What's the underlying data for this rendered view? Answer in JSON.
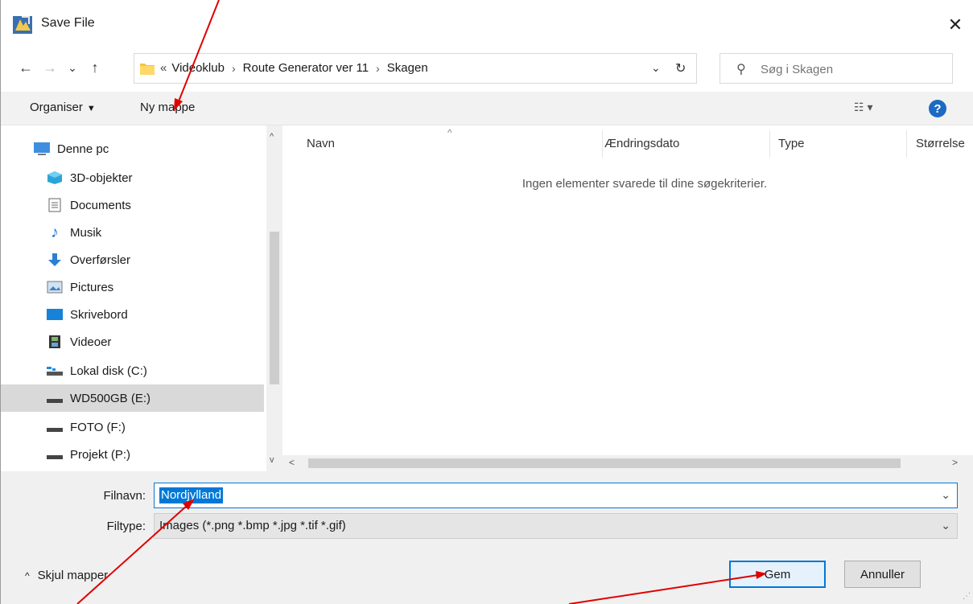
{
  "window": {
    "title": "Save File",
    "close_glyph": "✕"
  },
  "nav": {
    "back": "←",
    "forward": "→",
    "recent": "⌄",
    "up": "↑",
    "breadcrumb_prefix": "«",
    "breadcrumb": [
      "Videoklub",
      "Route Generator ver 11",
      "Skagen"
    ],
    "search_placeholder": "Søg i Skagen"
  },
  "toolbar": {
    "organise_label": "Organiser",
    "new_folder_label": "Ny mappe",
    "help_label": "?"
  },
  "sidebar": {
    "items": [
      {
        "label": "Denne pc",
        "icon": "monitor-icon"
      },
      {
        "label": "3D-objekter",
        "icon": "cube-icon"
      },
      {
        "label": "Documents",
        "icon": "document-icon"
      },
      {
        "label": "Musik",
        "icon": "music-icon"
      },
      {
        "label": "Overførsler",
        "icon": "download-icon"
      },
      {
        "label": "Pictures",
        "icon": "pictures-icon"
      },
      {
        "label": "Skrivebord",
        "icon": "desktop-icon"
      },
      {
        "label": "Videoer",
        "icon": "film-icon"
      },
      {
        "label": "Lokal disk (C:)",
        "icon": "drive-c-icon"
      },
      {
        "label": "WD500GB (E:)",
        "icon": "drive-icon",
        "selected": true
      },
      {
        "label": "FOTO (F:)",
        "icon": "drive-icon"
      },
      {
        "label": "Projekt (P:)",
        "icon": "drive-icon"
      }
    ]
  },
  "filelist": {
    "columns": [
      "Navn",
      "Ændringsdato",
      "Type",
      "Størrelse"
    ],
    "empty_message": "Ingen elementer svarede til dine søgekriterier."
  },
  "form": {
    "filename_label": "Filnavn:",
    "filename_value": "Nordjylland",
    "filetype_label": "Filtype:",
    "filetype_value": "Images (*.png *.bmp *.jpg *.tif *.gif)"
  },
  "footer": {
    "hide_folders_label": "Skjul mapper",
    "save_label": "Gem",
    "cancel_label": "Annuller"
  },
  "colors": {
    "accent": "#0078d7",
    "annotation": "#e00000",
    "help": "#1d6ac2"
  }
}
